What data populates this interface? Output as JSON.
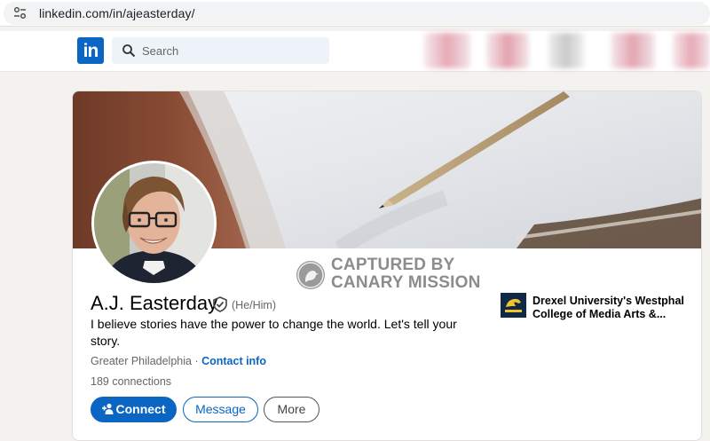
{
  "browser": {
    "url": "linkedin.com/in/ajeasterday/",
    "site_info_icon": "tune-icon"
  },
  "nav": {
    "logo_text": "in",
    "search_placeholder": "Search",
    "colors": {
      "brand": "#0a66c2"
    }
  },
  "watermark": {
    "line1": "CAPTURED BY",
    "line2": "CANARY MISSION",
    "icon": "canary-bird-icon"
  },
  "profile": {
    "name": "A.J. Easterday",
    "verified_icon": "shield-check-icon",
    "pronouns": "(He/Him)",
    "headline": "I believe stories have the power to change the world. Let's tell your story.",
    "location": "Greater Philadelphia",
    "separator": " · ",
    "contact_info": "Contact info",
    "connections": "189 connections"
  },
  "actions": {
    "connect": "Connect",
    "message": "Message",
    "more": "More"
  },
  "education": {
    "name": "Drexel University's Westphal College of Media Arts &...",
    "logo_icon": "drexel-dragon-icon"
  }
}
